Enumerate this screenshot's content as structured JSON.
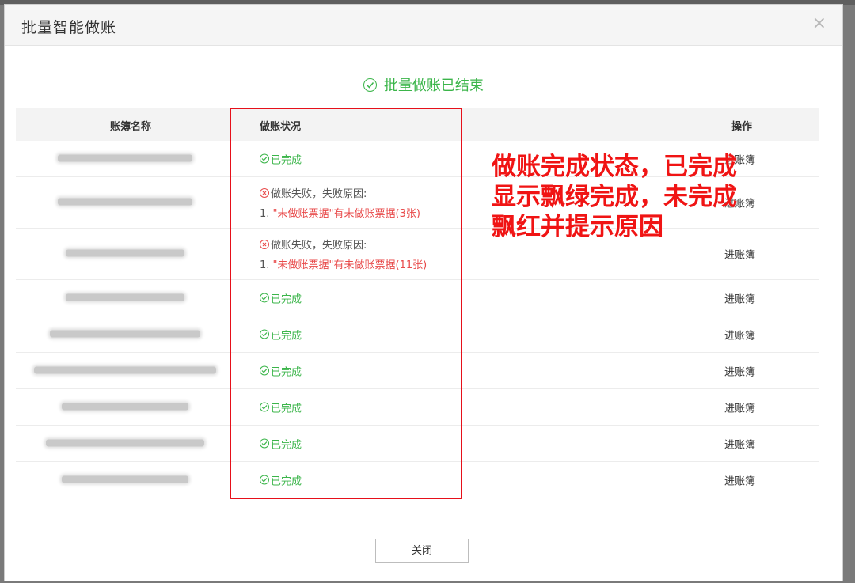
{
  "modal": {
    "title": "批量智能做账",
    "close_glyph": "×",
    "result_text": "批量做账已结束",
    "close_button": "关闭"
  },
  "table": {
    "headers": {
      "name": "账簿名称",
      "status": "做账状况",
      "op": "操作"
    },
    "rows": [
      {
        "name": "西安市某数据科技有限公司",
        "status": "ok",
        "status_text": "已完成",
        "op": "进账簿"
      },
      {
        "name": "陕西省某企业管理有限公司",
        "status": "fail",
        "fail_title": "做账失败，失败原因:",
        "fail_prefix": "1. ",
        "fail_reason_red": "\"未做账票据\"有未做账票据(3张)",
        "op": "进账簿"
      },
      {
        "name": "西安某商贸有限公司",
        "status": "fail",
        "fail_title": "做账失败，失败原因:",
        "fail_prefix": "1. ",
        "fail_reason_red": "\"未做账票据\"有未做账票据(11张)",
        "op": "进账簿"
      },
      {
        "name": "西安某门窗有限公司",
        "status": "ok",
        "status_text": "已完成",
        "op": "进账簿"
      },
      {
        "name": "陕西某建筑装饰工程有限公司",
        "status": "ok",
        "status_text": "已完成",
        "op": "进账簿"
      },
      {
        "name": "陕西某物流供应链管理有限公司",
        "status": "ok",
        "status_text": "已完成",
        "op": "进账簿"
      },
      {
        "name": "陕西某文化传媒有限公司",
        "status": "ok",
        "status_text": "已完成",
        "op": "进账簿"
      },
      {
        "name": "西安某信息技术咨询服务有限公司",
        "status": "ok",
        "status_text": "已完成",
        "op": "进账簿"
      },
      {
        "name": "西安某企业管理有限公司",
        "status": "ok",
        "status_text": "已完成",
        "op": "进账簿"
      }
    ]
  },
  "annotation": {
    "line1": "做账完成状态，已完成",
    "line2": "显示飘绿完成，未完成",
    "line3": "飘红并提示原因"
  },
  "colors": {
    "success": "#3bb54a",
    "failure": "#e84a4a",
    "annotation_red": "#f01414"
  }
}
